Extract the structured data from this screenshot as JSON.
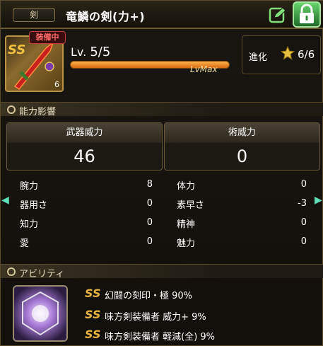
{
  "header": {
    "category": "剣",
    "title": "竜鱗の剣(力+)"
  },
  "item": {
    "equip_tag": "装備中",
    "level_prefix": "Lv.",
    "level_value": "5/5",
    "level_max_label": "LvMax",
    "level_progress": 1.0,
    "plus_count": "6"
  },
  "evolution": {
    "label": "進化",
    "value": "6/6"
  },
  "sections": {
    "stats": "能力影響",
    "abilities": "アビリティ"
  },
  "power": [
    {
      "label": "武器威力",
      "value": "46"
    },
    {
      "label": "術威力",
      "value": "0"
    }
  ],
  "stats": [
    {
      "name": "腕力",
      "value": "8"
    },
    {
      "name": "体力",
      "value": "0"
    },
    {
      "name": "器用さ",
      "value": "0"
    },
    {
      "name": "素早さ",
      "value": "-3"
    },
    {
      "name": "知力",
      "value": "0"
    },
    {
      "name": "精神",
      "value": "0"
    },
    {
      "name": "愛",
      "value": "0"
    },
    {
      "name": "魅力",
      "value": "0"
    }
  ],
  "abilities": [
    {
      "rank": "SS",
      "text": "幻闘の刻印・極 90%"
    },
    {
      "rank": "SS",
      "text": "味方剣装備者 威力+ 9%"
    },
    {
      "rank": "SS",
      "text": "味方剣装備者 軽減(全) 9%"
    }
  ],
  "icons": {
    "edit": "edit-icon",
    "lock": "lock-icon",
    "star": "star-icon"
  },
  "colors": {
    "accent_gold": "#b89544",
    "equip_red": "#ff6a6a",
    "level_bar": "#f0961e",
    "lock_green": "#3fae4c"
  }
}
